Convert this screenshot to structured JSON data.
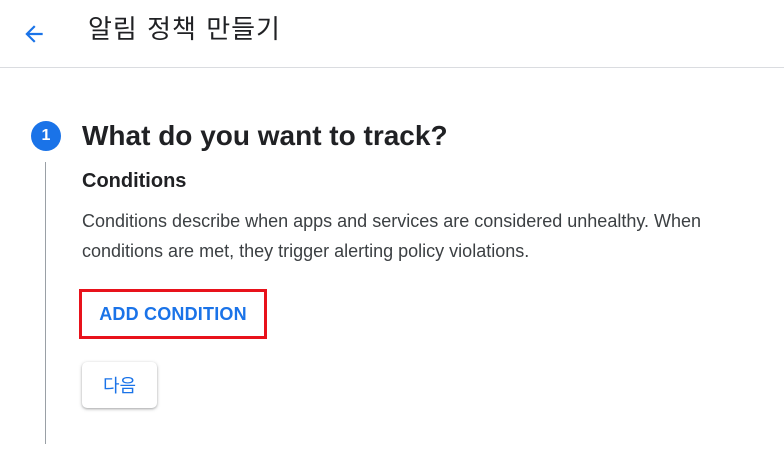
{
  "header": {
    "back_icon": "arrow-left-icon",
    "title": "알림 정책 만들기"
  },
  "step": {
    "number": "1",
    "title": "What do you want to track?",
    "section_heading": "Conditions",
    "description": "Conditions describe when apps and services are considered unhealthy. When conditions are met, they trigger alerting policy violations.",
    "add_condition_label": "ADD CONDITION",
    "next_label": "다음"
  },
  "colors": {
    "accent": "#1a73e8",
    "highlight": "#e8121b",
    "text": "#202124",
    "divider": "#dadce0"
  }
}
